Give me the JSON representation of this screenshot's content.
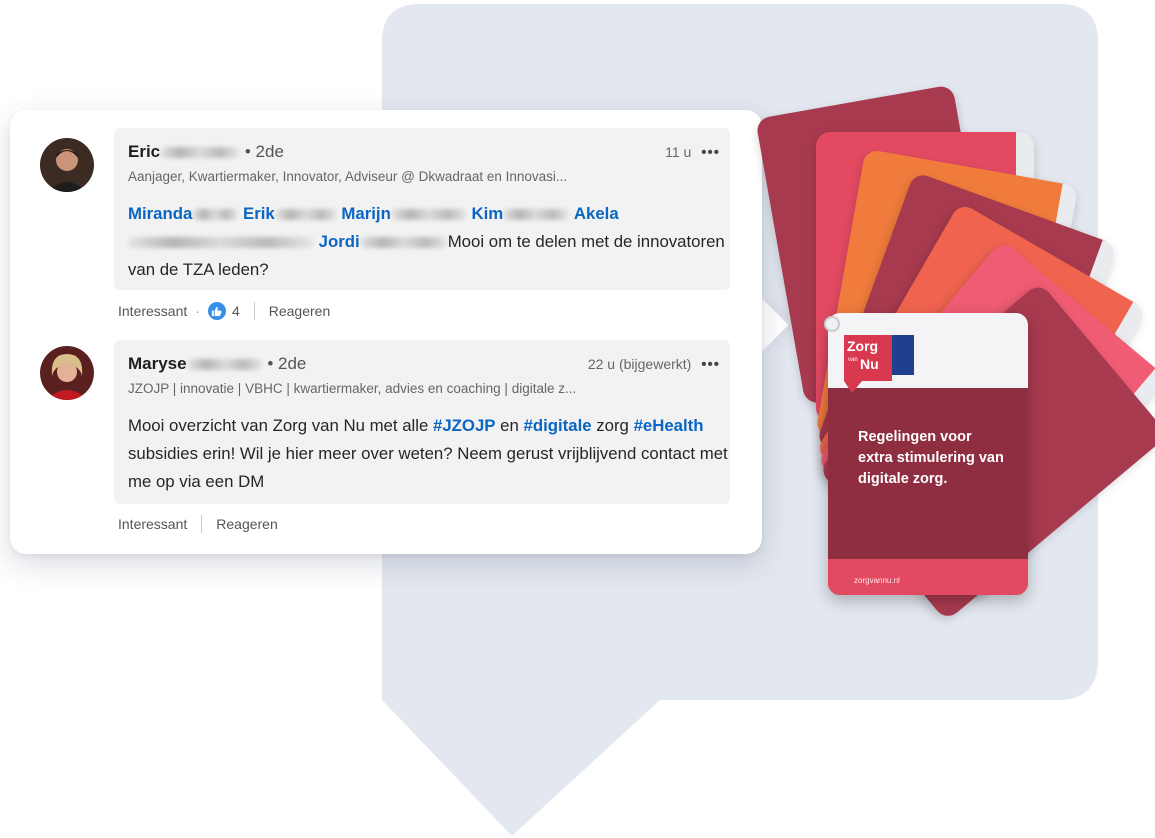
{
  "comments": [
    {
      "name": "Eric",
      "degree": "• 2de",
      "time": "11 u",
      "more": "•••",
      "headline": "Aanjager, Kwartiermaker, Innovator, Adviseur @ Dkwadraat en Innovasi...",
      "mentions": [
        "Miranda",
        "Erik",
        "Marijn",
        "Kim",
        "Akela",
        "Jordi"
      ],
      "body_text": "Mooi om te delen met de innovatoren van de TZA leden?",
      "body_line3": "innovatoren van de TZA leden?",
      "body_tail": "Mooi om te delen met de",
      "actions": {
        "react": "Interessant",
        "like_count": "4",
        "reply": "Reageren"
      }
    },
    {
      "name": "Maryse",
      "degree": "• 2de",
      "time": "22 u (bijgewerkt)",
      "more": "•••",
      "headline": "JZOJP | innovatie | VBHC | kwartiermaker, advies en coaching | digitale z...",
      "body_parts": {
        "p1": "Mooi overzicht van Zorg van Nu met alle ",
        "h1": "#JZOJP",
        "p2": " en ",
        "h2": "#digitale",
        "p3": " zorg ",
        "h3": "#eHealth",
        "p4": " subsidies erin! Wil je hier meer over weten? Neem gerust vrijblijvend contact met me op via een DM"
      },
      "actions": {
        "react": "Interessant",
        "reply": "Reageren"
      }
    }
  ],
  "card_fan": {
    "logo_line1": "Zorg",
    "logo_line2": "van",
    "logo_line3": "Nu",
    "front_text": "Regelingen voor extra stimulering van digitale zorg.",
    "url": "zorgvannu.nl",
    "colors": {
      "front": "#8f2e41",
      "pink": "#e34a62",
      "orange": "#f07b3c",
      "coral": "#f0644f",
      "wine": "#a83a4f",
      "rose": "#ef5c73"
    }
  },
  "colors": {
    "bubble_bg": "#e3e7ef",
    "link_blue": "#0a66c2",
    "like_blue": "#378fe9"
  }
}
